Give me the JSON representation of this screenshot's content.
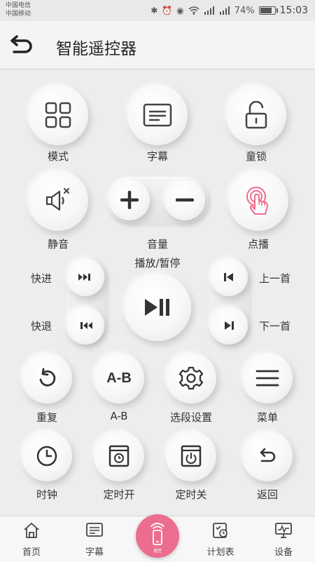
{
  "status_bar": {
    "carrier_1": "中国电信",
    "carrier_2": "中国移动",
    "battery": "74%",
    "battery_level": 0.74,
    "time": "15:03"
  },
  "header": {
    "title": "智能遥控器"
  },
  "buttons": {
    "mode": "模式",
    "subtitle": "字幕",
    "child_lock": "童锁",
    "mute": "静音",
    "volume": "音量",
    "on_demand": "点播",
    "play_pause": "播放/暂停",
    "fast_forward": "快进",
    "rewind": "快退",
    "previous": "上一首",
    "next": "下一首",
    "repeat": "重复",
    "ab": "A-B",
    "ab_icon_text": "A-B",
    "segment_settings": "选段设置",
    "menu": "菜单",
    "clock": "时钟",
    "timer_on": "定时开",
    "timer_off": "定时关",
    "back": "返回"
  },
  "bottom_nav": {
    "home": "首页",
    "subtitle": "字幕",
    "remote": "遥控",
    "schedule": "计划表",
    "devices": "设备"
  },
  "colors": {
    "accent": "#ec6d8f"
  }
}
